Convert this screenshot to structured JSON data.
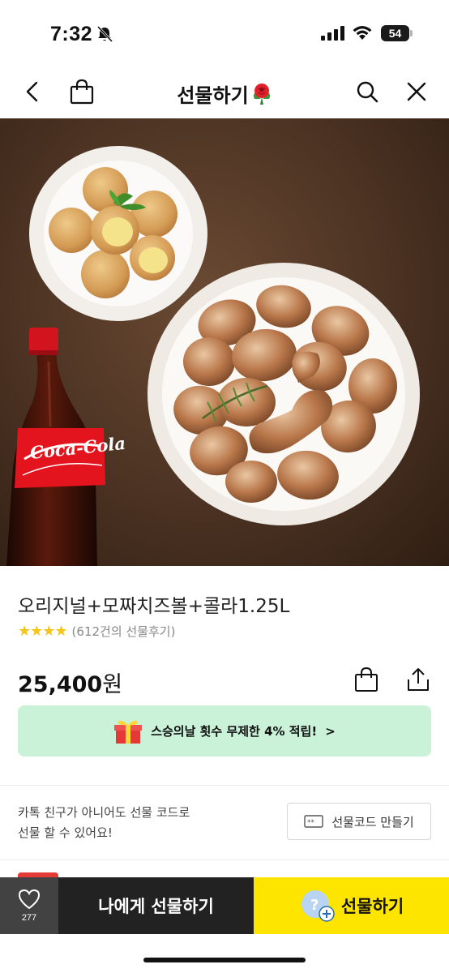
{
  "status_bar": {
    "time": "7:32",
    "battery": "54"
  },
  "nav": {
    "title": "선물하기"
  },
  "product": {
    "name": "오리지널+모짜치즈볼+콜라1.25L",
    "stars": "★★★★",
    "review_count": "(612건의 선물후기)",
    "price": "25,400",
    "price_unit": "원"
  },
  "promo": {
    "text": "스승의날 횟수 무제한 4% 적립!",
    "chevron": ">"
  },
  "gift_code": {
    "info_line1": "카톡 친구가 아니어도 선물 코드로",
    "info_line2": "선물 할 수 있어요!",
    "button_label": "선물코드 만들기"
  },
  "bottom_bar": {
    "like_count": "277",
    "self_gift_label": "나에게 선물하기",
    "gift_label": "선물하기"
  },
  "colors": {
    "promo_bg": "#c9f2d8",
    "gift_button": "#fee500",
    "self_gift_button": "#222222",
    "star": "#f5c518"
  },
  "icons": [
    "bell-off-icon",
    "signal-icon",
    "wifi-icon",
    "battery-icon",
    "back-icon",
    "shopping-bag-icon",
    "rose-icon",
    "search-icon",
    "close-icon",
    "gift-box-icon",
    "share-icon",
    "ticket-icon",
    "heart-icon",
    "add-friend-icon"
  ]
}
